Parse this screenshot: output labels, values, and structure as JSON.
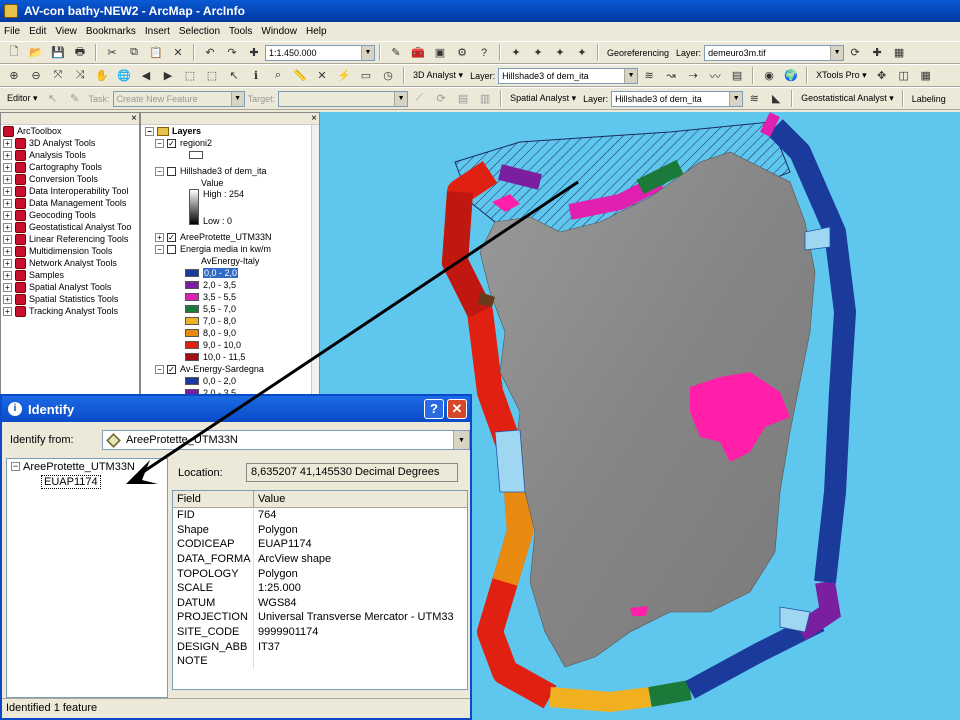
{
  "window": {
    "title": "AV-con bathy-NEW2 - ArcMap - ArcInfo"
  },
  "menu": [
    "File",
    "Edit",
    "View",
    "Bookmarks",
    "Insert",
    "Selection",
    "Tools",
    "Window",
    "Help"
  ],
  "toolbar1": {
    "scale": "1:1.450.000",
    "georef_label": "Georeferencing",
    "layer_label": "Layer:",
    "layer_value": "demeuro3m.tif"
  },
  "toolbar2": {
    "analyst_3d": "3D Analyst",
    "layer_label": "Layer:",
    "layer_value": "Hillshade3 of dem_ita",
    "xtools": "XTools Pro"
  },
  "toolbar3": {
    "editor": "Editor",
    "task_label": "Task:",
    "task_value": "Create New Feature",
    "target_label": "Target:",
    "spatial_analyst": "Spatial Analyst",
    "layer_label": "Layer:",
    "layer_value": "Hillshade3 of dem_ita",
    "geostat": "Geostatistical Analyst",
    "labeling": "Labeling"
  },
  "toolbox": {
    "root": "ArcToolbox",
    "items": [
      "3D Analyst Tools",
      "Analysis Tools",
      "Cartography Tools",
      "Conversion Tools",
      "Data Interoperability Tool",
      "Data Management Tools",
      "Geocoding Tools",
      "Geostatistical Analyst Too",
      "Linear Referencing Tools",
      "Multidimension Tools",
      "Network Analyst Tools",
      "Samples",
      "Spatial Analyst Tools",
      "Spatial Statistics Tools",
      "Tracking Analyst Tools"
    ]
  },
  "toc": {
    "root": "Layers",
    "regioni": "regioni2",
    "hillshade": "Hillshade3 of dem_ita",
    "hs_value": "Value",
    "hs_high": "High : 254",
    "hs_low": "Low : 0",
    "aree": "AreeProtette_UTM33N",
    "energia": "Energia media in kw/m",
    "avenergy_italy": "AvEnergy-Italy",
    "classes": [
      {
        "label": "0,0 - 2,0",
        "color": "#1a3a9c"
      },
      {
        "label": "2,0 - 3,5",
        "color": "#7a1fa0"
      },
      {
        "label": "3,5 - 5,5",
        "color": "#e020b0"
      },
      {
        "label": "5,5 - 7,0",
        "color": "#1a7a3a"
      },
      {
        "label": "7,0 - 8,0",
        "color": "#f0b020"
      },
      {
        "label": "8,0 - 9,0",
        "color": "#e88a10"
      },
      {
        "label": "9,0 - 10,0",
        "color": "#e02010"
      },
      {
        "label": "10,0 - 11,5",
        "color": "#a01010"
      }
    ],
    "av_sardegna": "Av-Energy-Sardegna",
    "sardegna_classes": [
      {
        "label": "0,0 - 2,0",
        "color": "#1a3a9c"
      },
      {
        "label": "2,0 - 3,5",
        "color": "#7a1fa0"
      }
    ]
  },
  "identify": {
    "title": "Identify",
    "help": "?",
    "close": "✕",
    "from_label": "Identify from:",
    "from_value": "AreeProtette_UTM33N",
    "tree_root": "AreeProtette_UTM33N",
    "tree_child": "EUAP1174",
    "location_label": "Location:",
    "location_value": "8,635207  41,145530 Decimal Degrees",
    "col_field": "Field",
    "col_value": "Value",
    "rows": [
      {
        "f": "FID",
        "v": "764"
      },
      {
        "f": "Shape",
        "v": "Polygon"
      },
      {
        "f": "CODICEAP",
        "v": "EUAP1174"
      },
      {
        "f": "DATA_FORMA",
        "v": "ArcView shape"
      },
      {
        "f": "TOPOLOGY",
        "v": "Polygon"
      },
      {
        "f": "SCALE",
        "v": "1:25.000"
      },
      {
        "f": "DATUM",
        "v": "WGS84"
      },
      {
        "f": "PROJECTION",
        "v": "Universal Transverse Mercator - UTM33"
      },
      {
        "f": "SITE_CODE",
        "v": "9999901174"
      },
      {
        "f": "DESIGN_ABB",
        "v": "IT37"
      },
      {
        "f": "NOTE",
        "v": ""
      }
    ],
    "status": "Identified 1 feature"
  },
  "colors": {
    "sea": "#5fc6ee",
    "land": "#8c8c8c",
    "protected": "#ff1fa8",
    "xp_blue": "#0a4ac8"
  }
}
